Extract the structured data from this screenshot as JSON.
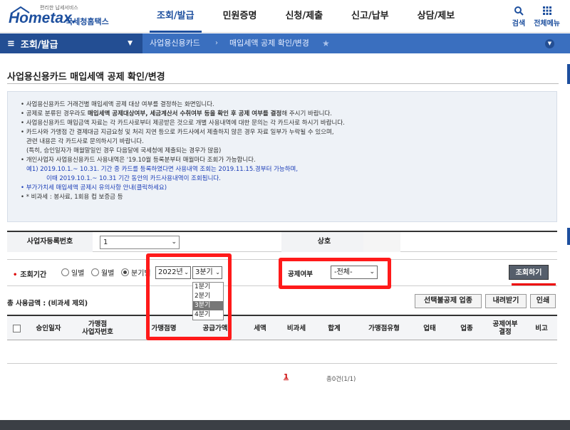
{
  "header": {
    "logo_small": "편리한 납세서비스",
    "logo_main": "Hometax.",
    "logo_sub": "국세청홈택스",
    "menu": [
      "조회/발급",
      "민원증명",
      "신청/제출",
      "신고/납부",
      "상담/제보"
    ],
    "active_menu": "조회/발급",
    "search_label": "검색",
    "allmenu_label": "전체메뉴"
  },
  "nav": {
    "home_label": "조회/발급",
    "crumb1": "사업용신용카드",
    "crumb2": "매입세액 공제 확인/변경"
  },
  "page": {
    "title": "사업용신용카드 매입세액 공제 확인/변경"
  },
  "info": {
    "lines": [
      "• 사업용신용카드 거래건별 매입세액 공제 대상 여부를 결정하는 화면입니다.",
      "• 사업용신용카드 매입금액 자료는 각 카드사로부터 제공받은 것으로 개별 사용내역에 대한 문의는 각 카드사로 하시기 바랍니다.",
      "• 카드사와 가맹점 간 결제대금 지급요청 및 처리 지연 등으로 카드사에서 제출하지 않은 경우 자료 일부가 누락될 수 있으며,",
      "관련 내용은 각 카드사로 문의하시기 바랍니다.",
      "(특히, 승인일자가 매월말일인 경우 다음달에 국세청에 제출되는 경우가 많음)",
      "• 개인사업자 사업용신용카드 사용내역은 '19.10월 등록분부터 매월마다 조회가 가능합니다.",
      "예1) 2019.10.1.~ 10.31. 기간 중 카드를 등록하였다면 사용내역 조회는 2019.11.15.경부터 가능하며,",
      "이때 2019.10.1.~ 10.31 기간 동안의 카드사용내역이 조회됩니다.",
      "• 부가가치세 매입세액 공제시 유의사항 안내(클릭하세요)",
      "• * 비과세 : 봉사료, 1회용 컵 보증금 등"
    ],
    "line2_prefix": "• 공제로 분류된 경우라도 ",
    "line2_bold": "매입세액 공제대상여부, 세금계산서 수취여부 등을 확인 후 공제 여부를 결정",
    "line2_suffix": "해 주시기 바랍니다."
  },
  "form": {
    "biz_no_label": "사업자등록번호",
    "biz_no_value": "1",
    "company_label": "상호",
    "period_label": "조회기간",
    "radio_daily": "일별",
    "radio_monthly": "월별",
    "radio_quarter": "분기별",
    "selected_radio": "분기별",
    "year_value": "2022년",
    "quarter_value": "3분기",
    "quarter_options": [
      "1분기",
      "2분기",
      "3분기",
      "4분기"
    ],
    "quarter_selected": "3분기",
    "deduct_label": "공제여부",
    "deduct_value": "-전체-",
    "search_button": "조회하기"
  },
  "list": {
    "total_label": "총 사용금액 : (비과세 제외)",
    "btn_select_save": "선택불공제 업종",
    "btn_download": "내려받기",
    "btn_print": "인쇄",
    "columns": [
      "승인일자",
      "가맹점\n사업자번호",
      "가맹점명",
      "공급가액",
      "세액",
      "비과세",
      "합계",
      "가맹점유형",
      "업태",
      "업종",
      "공제여부\n결정",
      "비고"
    ]
  },
  "pagination": {
    "current_page": "1",
    "count_text": "총0건(1/1)"
  },
  "colors": {
    "brand": "#1d4f9e",
    "nav": "#3a6fbf",
    "highlight": "#ff1a1a"
  }
}
